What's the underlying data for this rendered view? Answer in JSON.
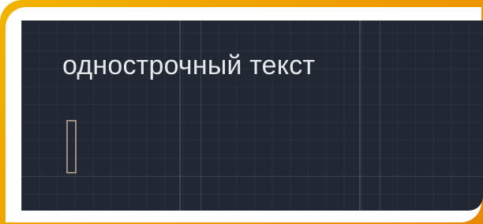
{
  "canvas": {
    "text": "однострочный текст",
    "background_color": "#212833",
    "text_color": "#e6e9ec"
  },
  "frame": {
    "accent": "#efa000"
  },
  "cursor": {
    "type": "text-insertion-cursor",
    "color": "#9c8f82"
  }
}
